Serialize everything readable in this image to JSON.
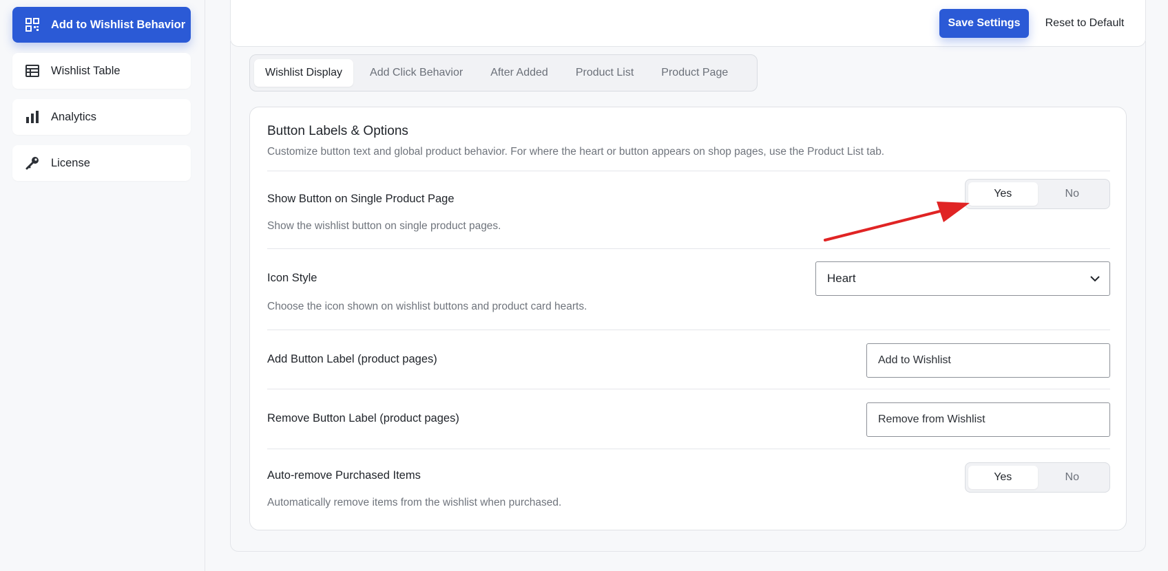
{
  "sidebar": {
    "items": [
      {
        "label": "Add to Wishlist Behavior",
        "icon": "grid-qr-icon",
        "active": true
      },
      {
        "label": "Wishlist Table",
        "icon": "table-icon",
        "active": false
      },
      {
        "label": "Analytics",
        "icon": "bar-chart-icon",
        "active": false
      },
      {
        "label": "License",
        "icon": "key-icon",
        "active": false
      }
    ]
  },
  "header": {
    "save_label": "Save Settings",
    "reset_label": "Reset to Default"
  },
  "tabs": [
    {
      "label": "Wishlist Display",
      "active": true
    },
    {
      "label": "Add Click Behavior",
      "active": false
    },
    {
      "label": "After Added",
      "active": false
    },
    {
      "label": "Product List",
      "active": false
    },
    {
      "label": "Product Page",
      "active": false
    }
  ],
  "section": {
    "title": "Button Labels & Options",
    "description": "Customize button text and global product behavior. For where the heart or button appears on shop pages, use the Product List tab."
  },
  "settings": {
    "show_button": {
      "label": "Show Button on Single Product Page",
      "help": "Show the wishlist button on single product pages.",
      "yes": "Yes",
      "no": "No",
      "selected": "Yes"
    },
    "icon_style": {
      "label": "Icon Style",
      "help": "Choose the icon shown on wishlist buttons and product card hearts.",
      "value": "Heart"
    },
    "add_label": {
      "label": "Add Button Label (product pages)",
      "value": "Add to Wishlist"
    },
    "remove_label": {
      "label": "Remove Button Label (product pages)",
      "value": "Remove from Wishlist"
    },
    "auto_remove": {
      "label": "Auto-remove Purchased Items",
      "help": "Automatically remove items from the wishlist when purchased.",
      "yes": "Yes",
      "no": "No",
      "selected": "Yes"
    }
  },
  "colors": {
    "accent": "#2b5ad6",
    "annotation_arrow": "#e02424"
  }
}
